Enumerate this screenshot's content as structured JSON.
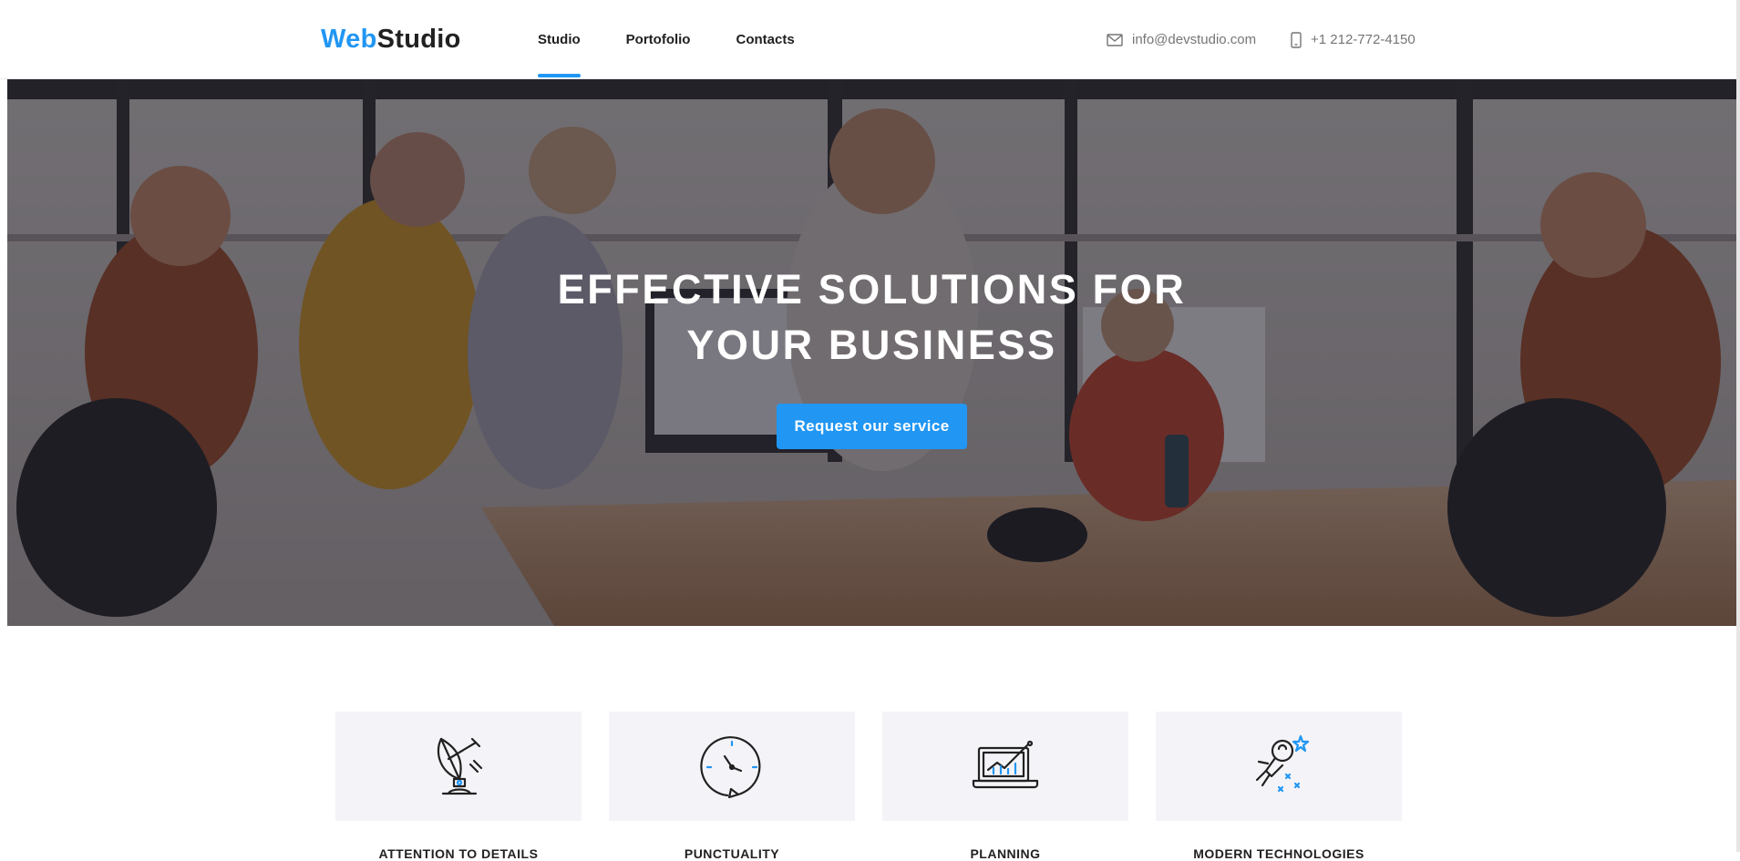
{
  "brand": {
    "part1": "Web",
    "part2": "Studio",
    "accent_color": "#2196f3"
  },
  "nav": {
    "items": [
      {
        "label": "Studio",
        "active": true
      },
      {
        "label": "Portofolio",
        "active": false
      },
      {
        "label": "Contacts",
        "active": false
      }
    ]
  },
  "contacts": {
    "email": "info@devstudio.com",
    "email_icon": "envelope-icon",
    "phone": "+1 212-772-4150",
    "phone_icon": "smartphone-icon"
  },
  "hero": {
    "title": "Effective solutions for your business",
    "button_label": "Request our service"
  },
  "features": [
    {
      "icon": "satellite-dish-icon",
      "title": "Attention to details"
    },
    {
      "icon": "clock-icon",
      "title": "Punctuality"
    },
    {
      "icon": "laptop-chart-icon",
      "title": "Planning"
    },
    {
      "icon": "astronaut-icon",
      "title": "Modern technologies"
    }
  ]
}
